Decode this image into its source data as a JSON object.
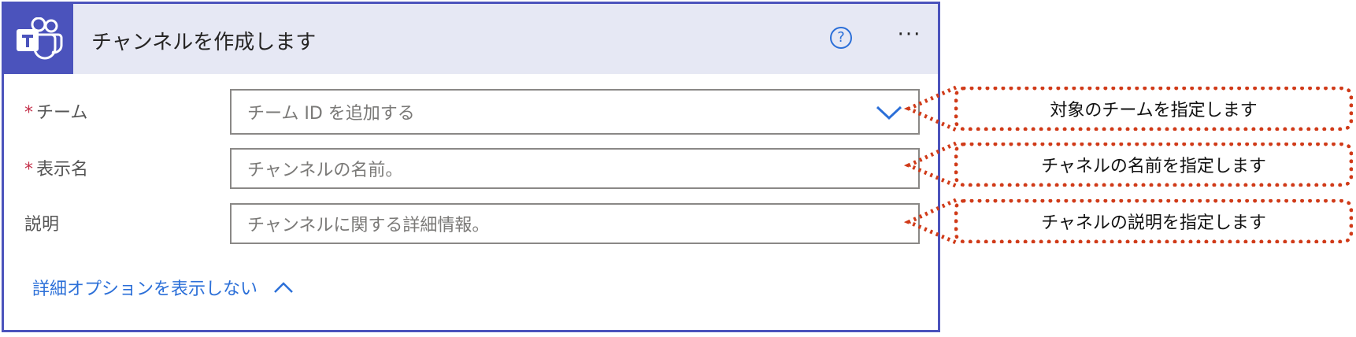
{
  "header": {
    "title": "チャンネルを作成します",
    "logo_icon": "teams-logo-icon",
    "help_icon": "help-icon",
    "help_glyph": "?",
    "more_icon": "more-options-icon",
    "more_glyph": "···"
  },
  "fields": {
    "team": {
      "required_mark": "*",
      "label": "チーム",
      "placeholder": "チーム ID を追加する",
      "dropdown_icon": "chevron-down-icon"
    },
    "display_name": {
      "required_mark": "*",
      "label": "表示名",
      "placeholder": "チャンネルの名前。"
    },
    "description": {
      "label": "説明",
      "placeholder": "チャンネルに関する詳細情報。"
    }
  },
  "advanced": {
    "label": "詳細オプションを表示しない",
    "icon": "chevron-up-icon"
  },
  "annotations": {
    "team": "対象のチームを指定します",
    "display_name": "チャネルの名前を指定します",
    "description": "チャネルの説明を指定します"
  },
  "colors": {
    "brand": "#4b53bc",
    "header_bg": "#e6e8f4",
    "link": "#2b6fd8",
    "required": "#c4314b",
    "annotation_border": "#d03a18"
  }
}
